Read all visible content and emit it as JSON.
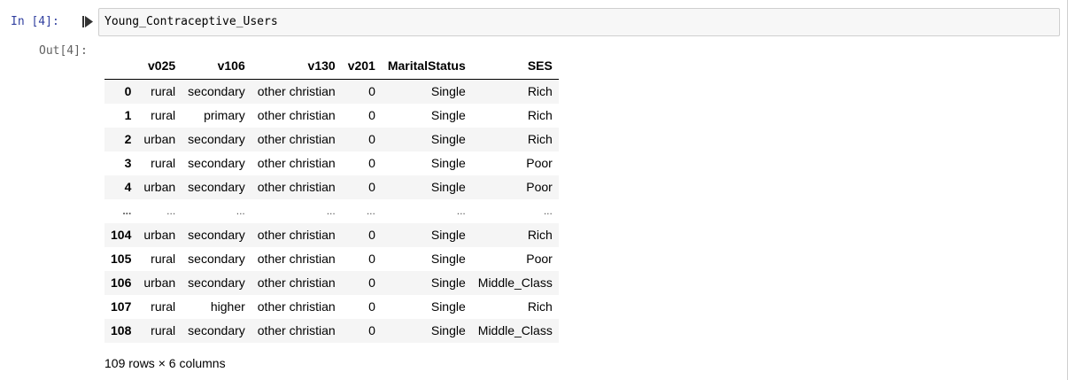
{
  "input_cell": {
    "prompt": "In [4]:",
    "code": "Young_Contraceptive_Users"
  },
  "output_cell": {
    "prompt": "Out[4]:"
  },
  "dataframe": {
    "columns": [
      "",
      "v025",
      "v106",
      "v130",
      "v201",
      "MaritalStatus",
      "SES"
    ],
    "rows": [
      [
        "0",
        "rural",
        "secondary",
        "other christian",
        "0",
        "Single",
        "Rich"
      ],
      [
        "1",
        "rural",
        "primary",
        "other christian",
        "0",
        "Single",
        "Rich"
      ],
      [
        "2",
        "urban",
        "secondary",
        "other christian",
        "0",
        "Single",
        "Rich"
      ],
      [
        "3",
        "rural",
        "secondary",
        "other christian",
        "0",
        "Single",
        "Poor"
      ],
      [
        "4",
        "urban",
        "secondary",
        "other christian",
        "0",
        "Single",
        "Poor"
      ],
      [
        "...",
        "...",
        "...",
        "...",
        "...",
        "...",
        "..."
      ],
      [
        "104",
        "urban",
        "secondary",
        "other christian",
        "0",
        "Single",
        "Rich"
      ],
      [
        "105",
        "rural",
        "secondary",
        "other christian",
        "0",
        "Single",
        "Poor"
      ],
      [
        "106",
        "urban",
        "secondary",
        "other christian",
        "0",
        "Single",
        "Middle_Class"
      ],
      [
        "107",
        "rural",
        "higher",
        "other christian",
        "0",
        "Single",
        "Rich"
      ],
      [
        "108",
        "rural",
        "secondary",
        "other christian",
        "0",
        "Single",
        "Middle_Class"
      ]
    ],
    "shape": "109 rows × 6 columns"
  },
  "icons": {
    "run": "run-cell-icon"
  },
  "colors": {
    "in_prompt": "#303f9f",
    "out_prompt": "#616161",
    "input_bg": "#f7f7f7",
    "stripe": "#f5f5f5"
  }
}
